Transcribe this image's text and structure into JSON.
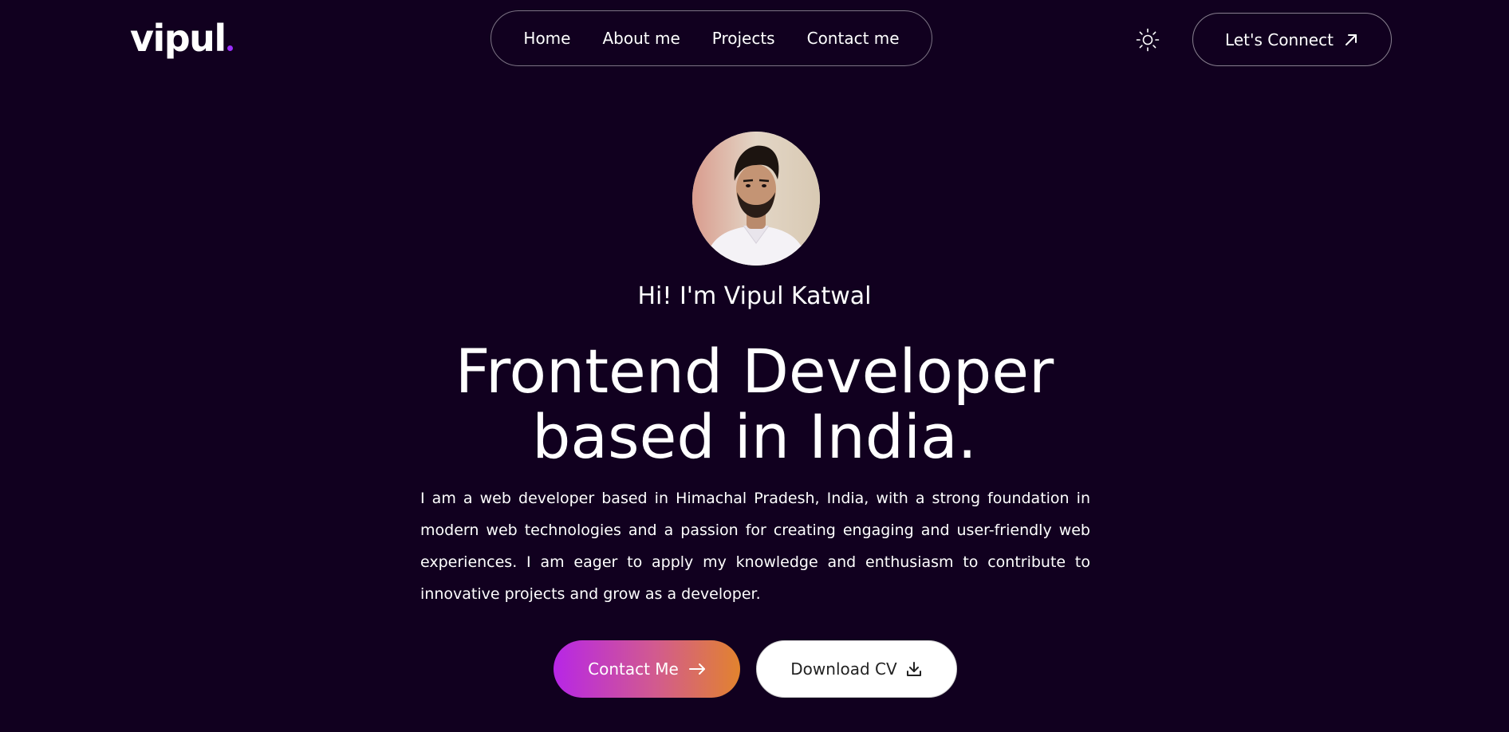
{
  "brand": {
    "name": "vipul",
    "dot_color": "#9b2fff"
  },
  "nav": {
    "links": [
      {
        "label": "Home"
      },
      {
        "label": "About me"
      },
      {
        "label": "Projects"
      },
      {
        "label": "Contact me"
      }
    ],
    "theme_icon": "sun-icon",
    "cta_label": "Let's Connect",
    "cta_icon": "arrow-up-right-icon"
  },
  "hero": {
    "greeting": "Hi! I'm Vipul Katwal",
    "headline_line1": "Frontend Developer",
    "headline_line2": "based in India.",
    "bio": "I am a web developer based in Himachal Pradesh, India, with a strong foundation in modern web technologies and a passion for creating engaging and user-friendly web experiences. I am eager to apply my knowledge and enthusiasm to contribute to innovative projects and grow as a developer.",
    "primary_button": {
      "label": "Contact Me",
      "icon": "arrow-right-icon"
    },
    "secondary_button": {
      "label": "Download CV",
      "icon": "download-icon"
    }
  },
  "colors": {
    "background": "#11001f",
    "gradient_start": "#b726e6",
    "gradient_end": "#e2832e",
    "text": "#ffffff"
  }
}
